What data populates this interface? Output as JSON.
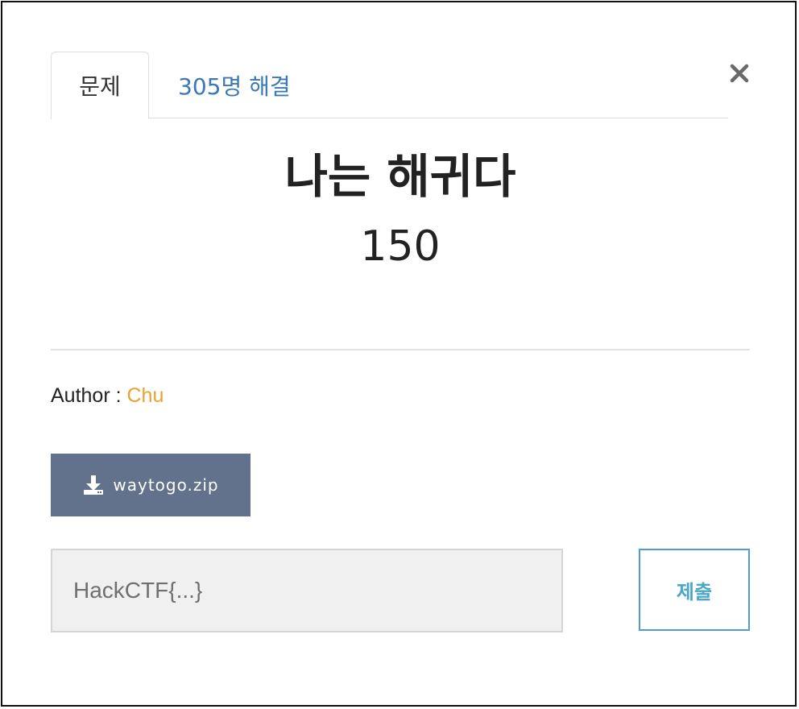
{
  "tabs": {
    "challenge_label": "문제",
    "solves_label": "305명 해결"
  },
  "close": {
    "icon": "close-icon",
    "glyph": "×"
  },
  "challenge": {
    "title": "나는 해귀다",
    "points": "150",
    "author_label": "Author : ",
    "author_name": "Chu"
  },
  "file": {
    "icon": "download-icon",
    "name": "waytogo.zip"
  },
  "flag": {
    "placeholder": "HackCTF{...}",
    "value": ""
  },
  "submit": {
    "label": "제출"
  },
  "colors": {
    "solves_link": "#3a78b6",
    "author_name": "#eba12f",
    "file_button_bg": "#62718c",
    "submit_border": "#4d9fd3",
    "submit_text": "#4aa8c7"
  }
}
